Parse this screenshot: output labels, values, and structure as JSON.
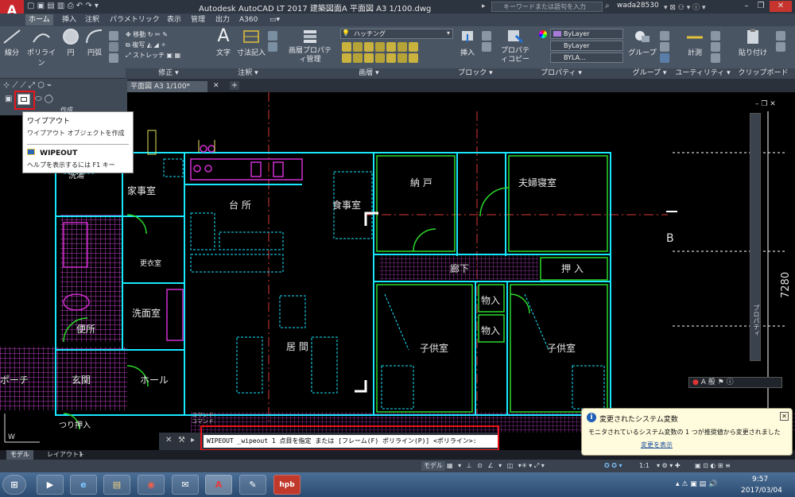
{
  "app": {
    "logo_text": "A",
    "logo_sub": "LT",
    "window_title": "Autodesk AutoCAD LT 2017    建築図面A  平面図 A3 1/100.dwg",
    "search_placeholder": "キーワードまたは語句を入力",
    "user": "wada28530"
  },
  "ribbon": {
    "tabs": [
      {
        "label": "ホーム"
      },
      {
        "label": "挿入"
      },
      {
        "label": "注釈"
      },
      {
        "label": "パラメトリック"
      },
      {
        "label": "表示"
      },
      {
        "label": "管理"
      },
      {
        "label": "出力"
      },
      {
        "label": "A360"
      }
    ],
    "draw_tools": [
      "線分",
      "ポリライン",
      "円",
      "円弧"
    ],
    "modify_tools": [
      "移動",
      "複写",
      "ストレッチ"
    ],
    "annotation_tools": [
      "文字",
      "寸法記入"
    ],
    "layer_tool": "画層プロパティ管理",
    "layer_name": "ハッチング",
    "insert_tool": "挿入",
    "property_copy": "プロパティコピー",
    "color_value": "ByLayer",
    "linetype_value": "ByLayer",
    "lineweight_value": "BYLA...",
    "group_tool": "グループ",
    "measure_tool": "計測",
    "paste_tool": "貼り付け",
    "panels": [
      "修正 ▾",
      "注釈 ▾",
      "画層 ▾",
      "ブロック ▾",
      "プロパティ ▾",
      "グループ ▾",
      "ユーティリティ ▾",
      "クリップボード"
    ]
  },
  "palette": {
    "label": "作成"
  },
  "tooltip": {
    "title": "ワイプアウト",
    "desc": "ワイプアウト オブジェクトを作成",
    "command": "WIPEOUT",
    "help": "ヘルプを表示するには F1 キー"
  },
  "doc_tab": "平面図 A3 1/100*",
  "rooms": [
    {
      "name": "家事室"
    },
    {
      "name": "台 所"
    },
    {
      "name": "食事室"
    },
    {
      "name": "納 戸"
    },
    {
      "name": "夫婦寝室"
    },
    {
      "name": "更衣室"
    },
    {
      "name": "洗面室"
    },
    {
      "name": "廊下"
    },
    {
      "name": "押 入"
    },
    {
      "name": "物入"
    },
    {
      "name": "物入"
    },
    {
      "name": "居 間"
    },
    {
      "name": "子供室"
    },
    {
      "name": "子供室"
    },
    {
      "name": "便所"
    },
    {
      "name": "玄関"
    },
    {
      "name": "ホール"
    },
    {
      "name": "ポーチ"
    },
    {
      "name": "つり押入"
    },
    {
      "name": "洗湯"
    }
  ],
  "drawing_labels": {
    "section_mark": "B",
    "dimension": "7280",
    "palette_side": "プロパティ"
  },
  "command": {
    "history": "コマンド:\nコマンド:",
    "prompt": "WIPEOUT _wipeout 1 点目を指定 または [フレーム(F) ポリライン(P)] <ポリライン>:"
  },
  "layout_tabs": [
    {
      "label": "モデル"
    },
    {
      "label": "レイアウト1"
    },
    {
      "label": "+"
    }
  ],
  "status": {
    "model": "モデル",
    "scale": "1:1",
    "annot": "A 般"
  },
  "notification": {
    "title": "変更されたシステム変数",
    "body": "モニタされているシステム変数の 1 つが推奨値から変更されました",
    "link": "変更を表示"
  },
  "taskbar": {
    "apps": [
      "⊞",
      "▶",
      "e",
      "▤",
      "◉",
      "✉",
      "A",
      "✎",
      "hpb"
    ],
    "time": "9:57",
    "date": "2017/03/04"
  },
  "colors": {
    "wall": "#19e6ff",
    "door": "#2bd92b",
    "magenta": "#d12fd1",
    "yellow": "#e6e65a",
    "red_center": "#d7383a"
  }
}
